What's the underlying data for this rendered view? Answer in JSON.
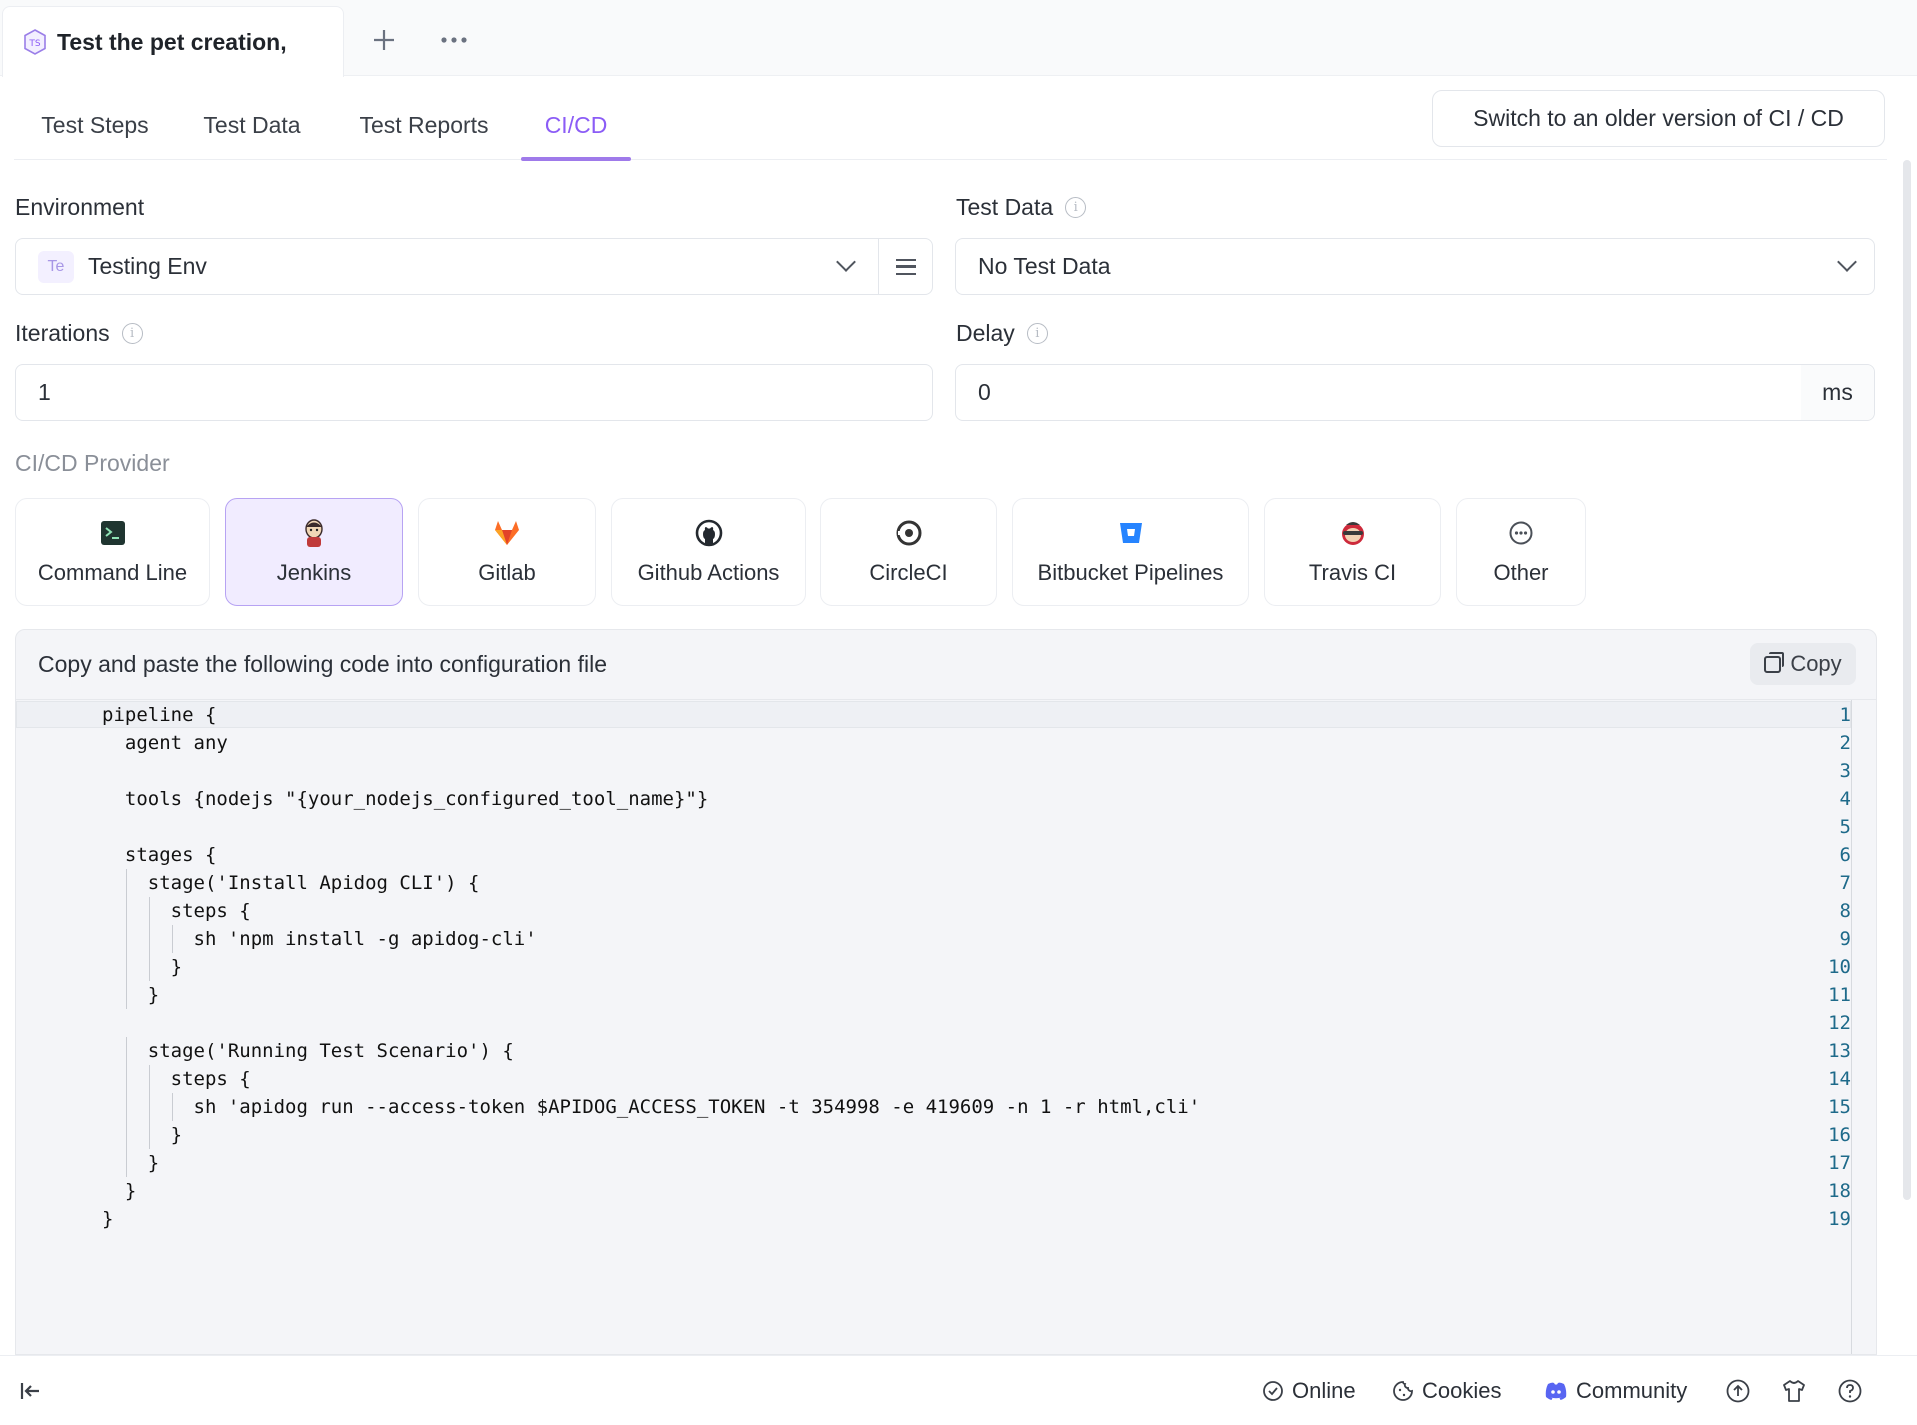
{
  "doc_tab": {
    "badge": "TS",
    "title": "Test the pet creation,"
  },
  "tabs": [
    "Test Steps",
    "Test Data",
    "Test Reports",
    "CI/CD"
  ],
  "active_tab": "CI/CD",
  "switch_button": "Switch to an older version of CI / CD",
  "environment": {
    "label": "Environment",
    "badge": "Te",
    "value": "Testing Env"
  },
  "test_data": {
    "label": "Test Data",
    "value": "No Test Data"
  },
  "iterations": {
    "label": "Iterations",
    "value": "1"
  },
  "delay": {
    "label": "Delay",
    "value": "0",
    "unit": "ms"
  },
  "provider_label": "CI/CD Provider",
  "providers": [
    {
      "label": "Command Line",
      "icon": "terminal-icon"
    },
    {
      "label": "Jenkins",
      "icon": "jenkins-icon",
      "selected": true
    },
    {
      "label": "Gitlab",
      "icon": "gitlab-icon"
    },
    {
      "label": "Github Actions",
      "icon": "github-icon"
    },
    {
      "label": "CircleCI",
      "icon": "circleci-icon"
    },
    {
      "label": "Bitbucket Pipelines",
      "icon": "bitbucket-icon"
    },
    {
      "label": "Travis CI",
      "icon": "travis-icon"
    },
    {
      "label": "Other",
      "icon": "more-circle-icon"
    }
  ],
  "code_panel": {
    "instruction": "Copy and paste the following code into configuration file",
    "copy_label": "Copy",
    "lines": [
      "pipeline {",
      "  agent any",
      "",
      "  tools {nodejs \"{your_nodejs_configured_tool_name}\"}",
      "",
      "  stages {",
      "    stage('Install Apidog CLI') {",
      "      steps {",
      "        sh 'npm install -g apidog-cli'",
      "      }",
      "    }",
      "",
      "    stage('Running Test Scenario') {",
      "      steps {",
      "        sh 'apidog run --access-token $APIDOG_ACCESS_TOKEN -t 354998 -e 419609 -n 1 -r html,cli'",
      "      }",
      "    }",
      "  }",
      "}"
    ]
  },
  "statusbar": {
    "online": "Online",
    "cookies": "Cookies",
    "community": "Community"
  },
  "colors": {
    "accent": "#8b5cf6",
    "selected_bg": "#f1ecff",
    "line_number": "#1e6a8a"
  }
}
